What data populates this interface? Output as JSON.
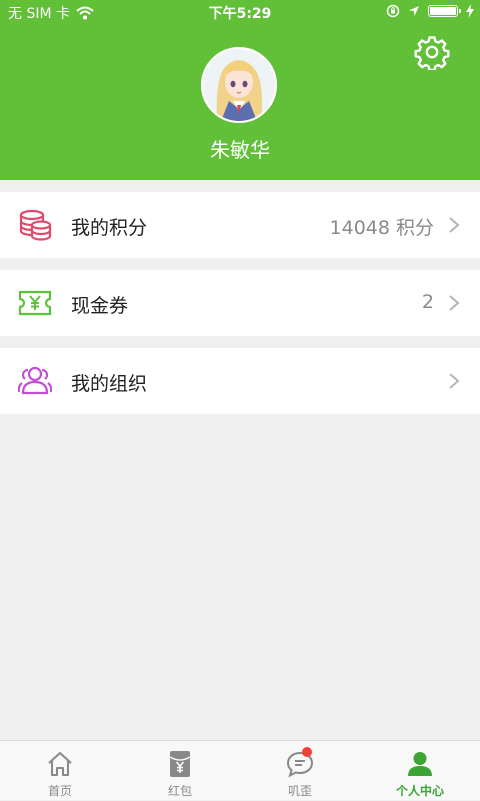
{
  "status_bar": {
    "carrier": "无 SIM 卡",
    "time": "下午5:29",
    "battery_level": 1.0
  },
  "profile": {
    "username": "朱敏华",
    "avatar_icon": "anime-girl-avatar"
  },
  "colors": {
    "header_green": "#62bf38",
    "points_icon": "#e04a6c",
    "coupon_icon": "#5cc23b",
    "org_icon": "#c34fd6",
    "active_tab": "#3aa534",
    "badge_red": "#f0413a"
  },
  "menu": [
    {
      "label": "我的积分",
      "value": "14048 积分",
      "icon": "coins-stack-icon"
    },
    {
      "label": "现金券",
      "value": "2",
      "icon": "yen-ticket-icon"
    },
    {
      "label": "我的组织",
      "value": "",
      "icon": "group-icon"
    }
  ],
  "tabbar": [
    {
      "label": "首页",
      "icon": "home-icon",
      "active": false
    },
    {
      "label": "红包",
      "icon": "red-envelope-icon",
      "active": false
    },
    {
      "label": "叽歪",
      "icon": "chat-bubble-icon",
      "active": false,
      "badge": true
    },
    {
      "label": "个人中心",
      "icon": "person-icon",
      "active": true
    }
  ]
}
